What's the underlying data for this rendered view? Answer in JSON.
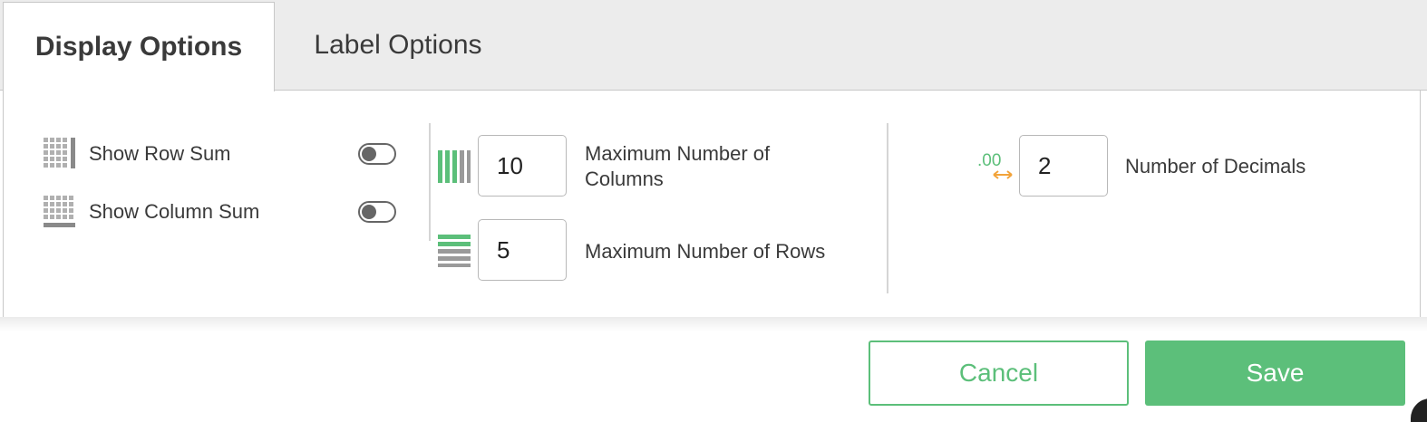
{
  "tabs": [
    {
      "label": "Display Options",
      "active": true
    },
    {
      "label": "Label Options",
      "active": false
    }
  ],
  "options": {
    "show_row_sum": {
      "label": "Show Row Sum",
      "enabled": false
    },
    "show_column_sum": {
      "label": "Show Column Sum",
      "enabled": false
    }
  },
  "limits": {
    "max_columns": {
      "label": "Maximum Number of Columns",
      "value": "10"
    },
    "max_rows": {
      "label": "Maximum Number of Rows",
      "value": "5"
    }
  },
  "decimals": {
    "icon_text": ".00",
    "label": "Number of Decimals",
    "value": "2"
  },
  "footer": {
    "cancel_label": "Cancel",
    "save_label": "Save"
  },
  "colors": {
    "accent": "#5cbf7a",
    "icon_gray": "#a0a0a0",
    "decimal_orange": "#f2a33a"
  }
}
